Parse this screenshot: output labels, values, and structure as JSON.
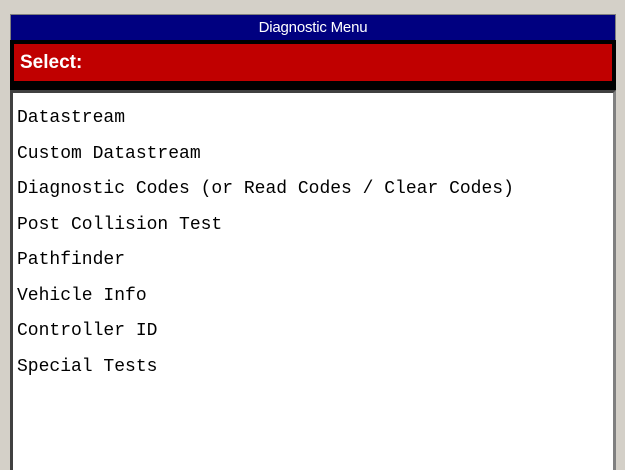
{
  "window": {
    "title": "Diagnostic Menu"
  },
  "header": {
    "select_label": "Select:"
  },
  "menu": {
    "items": [
      {
        "label": "Datastream"
      },
      {
        "label": "Custom Datastream"
      },
      {
        "label": "Diagnostic Codes (or Read Codes / Clear Codes)"
      },
      {
        "label": "Post Collision Test"
      },
      {
        "label": "Pathfinder"
      },
      {
        "label": "Vehicle Info"
      },
      {
        "label": "Controller ID"
      },
      {
        "label": "Special Tests"
      }
    ]
  },
  "colors": {
    "title_bar": "#000080",
    "select_bar": "#c00000",
    "list_background": "#ffffff"
  }
}
